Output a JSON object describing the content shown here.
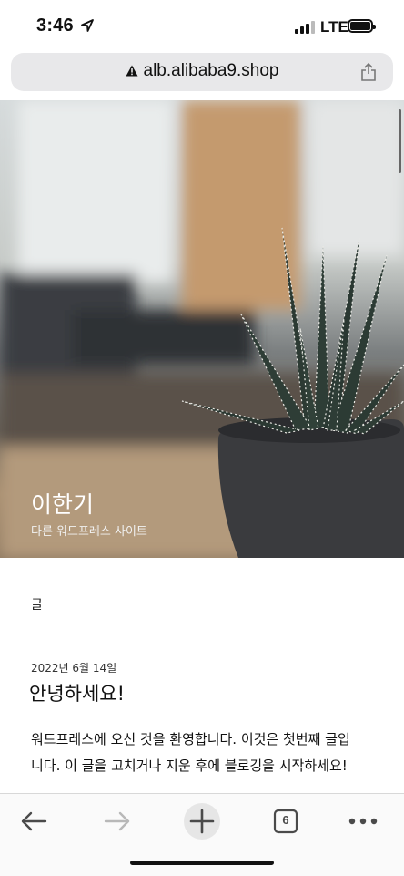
{
  "status_bar": {
    "time": "3:46",
    "network": "LTE"
  },
  "browser": {
    "url": "alb.alibaba9.shop",
    "tabs_count": "6"
  },
  "hero": {
    "site_title": "이한기",
    "tagline": "다른 워드프레스 사이트"
  },
  "content": {
    "section_label": "글",
    "post": {
      "date": "2022년 6월 14일",
      "title": "안녕하세요!",
      "body_line1": "워드프레스에 오신 것을 환영합니다. 이것은 첫번째 글입",
      "body_line2": "니다. 이 글을 고치거나 지운 후에 블로깅을 시작하세요!"
    }
  },
  "icons": {
    "location": "location-arrow-icon",
    "signal": "cellular-signal-icon",
    "battery": "battery-icon",
    "warning": "not-secure-warning-icon",
    "share": "share-icon",
    "back": "back-arrow-icon",
    "forward": "forward-arrow-icon",
    "new_tab": "plus-icon",
    "tabs": "tabs-icon",
    "more": "more-icon"
  },
  "colors": {
    "toolbar_icon": "#4a4a4a",
    "toolbar_icon_disabled": "#b8b8b8",
    "url_bar_bg": "#e8e8ea"
  }
}
